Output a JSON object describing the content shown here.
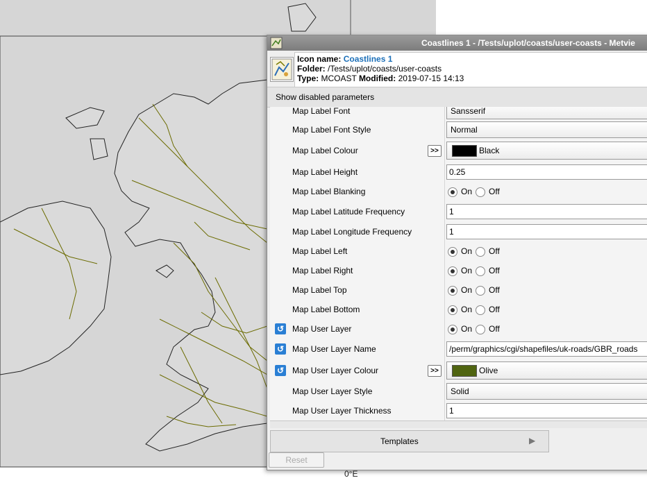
{
  "colors": {
    "map_sea": "#d6d6d6",
    "map_land": "#d9d9d9",
    "roads": "#6b6b00",
    "black_swatch": "#000000",
    "olive_swatch": "#4f6410"
  },
  "map": {
    "axis_label": "0°E"
  },
  "window": {
    "title": "Coastlines 1 - /Tests/uplot/coasts/user-coasts - Metvie"
  },
  "info": {
    "icon_name_label": "Icon name:",
    "icon_name_value": "Coastlines 1",
    "folder_label": "Folder:",
    "folder_value": "/Tests/uplot/coasts/user-coasts",
    "type_label": "Type:",
    "type_value": "MCOAST",
    "modified_label": "Modified:",
    "modified_value": "2019-07-15 14:13"
  },
  "show_disabled_label": "Show disabled parameters",
  "params": [
    {
      "label": "Map Label Font",
      "kind": "menu",
      "value": "Sansserif"
    },
    {
      "label": "Map Label Font Style",
      "kind": "menu",
      "value": "Normal"
    },
    {
      "label": "Map Label Colour",
      "kind": "colour",
      "value": "Black",
      "helper": true
    },
    {
      "label": "Map Label Height",
      "kind": "text",
      "value": "0.25"
    },
    {
      "label": "Map Label Blanking",
      "kind": "onoff",
      "value": "On"
    },
    {
      "label": "Map Label Latitude Frequency",
      "kind": "text",
      "value": "1"
    },
    {
      "label": "Map Label Longitude Frequency",
      "kind": "text",
      "value": "1"
    },
    {
      "label": "Map Label Left",
      "kind": "onoff",
      "value": "On"
    },
    {
      "label": "Map Label Right",
      "kind": "onoff",
      "value": "On"
    },
    {
      "label": "Map Label Top",
      "kind": "onoff",
      "value": "On"
    },
    {
      "label": "Map Label Bottom",
      "kind": "onoff",
      "value": "On"
    },
    {
      "label": "Map User Layer",
      "kind": "onoff",
      "value": "On",
      "revert": true
    },
    {
      "label": "Map User Layer Name",
      "kind": "text",
      "value": "/perm/graphics/cgi/shapefiles/uk-roads/GBR_roads",
      "revert": true
    },
    {
      "label": "Map User Layer Colour",
      "kind": "colour",
      "value": "Olive",
      "helper": true,
      "revert": true
    },
    {
      "label": "Map User Layer Style",
      "kind": "menu",
      "value": "Solid"
    },
    {
      "label": "Map User Layer Thickness",
      "kind": "text",
      "value": "1"
    }
  ],
  "onoff_labels": {
    "on": "On",
    "off": "Off"
  },
  "templates_label": "Templates",
  "reset_label": "Reset"
}
